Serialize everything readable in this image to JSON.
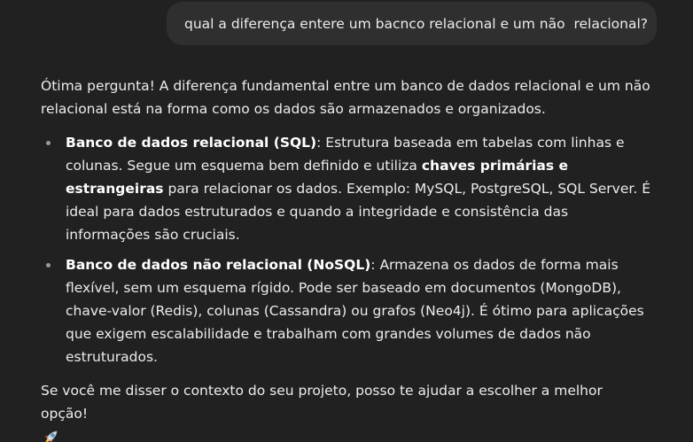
{
  "user_message": "qual a diferença entere um bacnco relacional e um não  relacional?",
  "assistant": {
    "intro": "Ótima pergunta! A diferença fundamental entre um banco de dados relacional e um não relacional está na forma como os dados são armazenados e organizados.",
    "items": [
      {
        "title": "Banco de dados relacional (SQL)",
        "text_1": ": Estrutura baseada em tabelas com linhas e colunas. Segue um esquema bem definido e utiliza ",
        "bold_2": "chaves primárias e estrangeiras",
        "text_2": " para relacionar os dados. Exemplo: MySQL, PostgreSQL, SQL Server. É ideal para dados estruturados e quando a integridade e consistência das informações são cruciais."
      },
      {
        "title": "Banco de dados não relacional (NoSQL)",
        "text_1": ": Armazena os dados de forma mais flexível, sem um esquema rígido. Pode ser baseado em documentos (MongoDB), chave-valor (Redis), colunas (Cassandra) ou grafos (Neo4j). É ótimo para aplicações que exigem escalabilidade e trabalham com grandes volumes de dados não estruturados."
      }
    ],
    "outro": "Se você me disser o contexto do seu projeto, posso te ajudar a escolher a melhor opção!",
    "emoji_icon": "rocket-icon"
  }
}
